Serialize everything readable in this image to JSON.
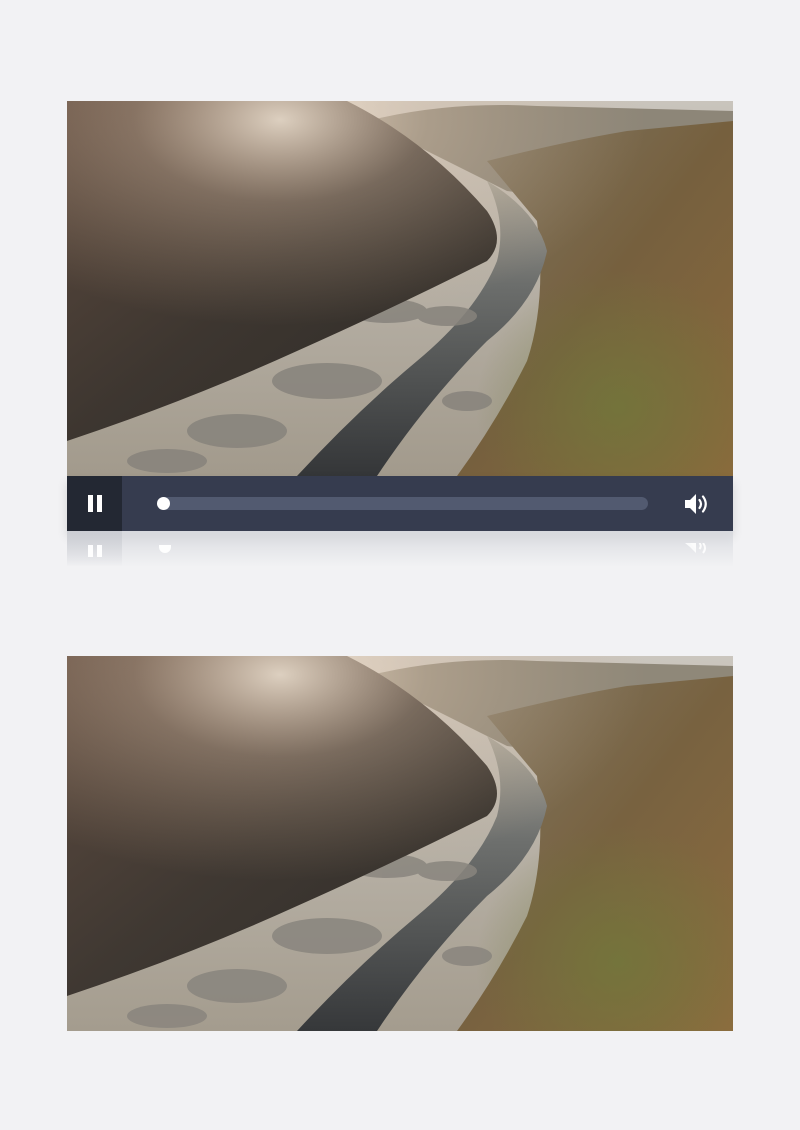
{
  "player": {
    "state": "playing",
    "progress": 0.0,
    "buttons": {
      "play_pause_icon": "pause-icon",
      "volume_icon": "volume-icon"
    },
    "colors": {
      "control_bar": "#363c4f",
      "play_button_bg": "#232833",
      "track": "#525a70",
      "knob": "#ffffff"
    }
  },
  "scene": {
    "description_icon": "river-gorge-video-frame"
  }
}
